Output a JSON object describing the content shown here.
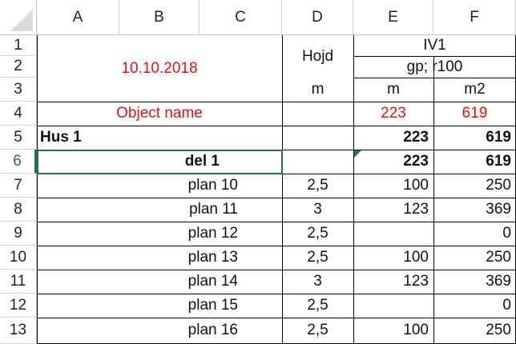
{
  "columns": [
    "A",
    "B",
    "C",
    "D",
    "E",
    "F"
  ],
  "rows": [
    "1",
    "2",
    "3",
    "4",
    "5",
    "6",
    "7",
    "8",
    "9",
    "10",
    "11",
    "12",
    "13"
  ],
  "header": {
    "date": "10.10.2018",
    "hojd": "Hojd",
    "iv1": "IV1",
    "gp": "gp; r100",
    "unit_d": "m",
    "unit_e": "m",
    "unit_f": "m2",
    "object_name": "Object name",
    "obj_e": "223",
    "obj_f": "619"
  },
  "group": {
    "label": "Hus 1",
    "e": "223",
    "f": "619"
  },
  "subgroup": {
    "label": "del 1",
    "e": "223",
    "f": "619"
  },
  "plans": [
    {
      "label": "plan 10",
      "d": "2,5",
      "e": "100",
      "f": "250"
    },
    {
      "label": "plan 11",
      "d": "3",
      "e": "123",
      "f": "369"
    },
    {
      "label": "plan 12",
      "d": "2,5",
      "e": "",
      "f": "0"
    },
    {
      "label": "plan 13",
      "d": "2,5",
      "e": "100",
      "f": "250"
    },
    {
      "label": "plan 14",
      "d": "3",
      "e": "123",
      "f": "369"
    },
    {
      "label": "plan 15",
      "d": "2,5",
      "e": "",
      "f": "0"
    },
    {
      "label": "plan 16",
      "d": "2,5",
      "e": "100",
      "f": "250"
    }
  ],
  "colors": {
    "red": "#e3120b",
    "selection": "#217346"
  }
}
